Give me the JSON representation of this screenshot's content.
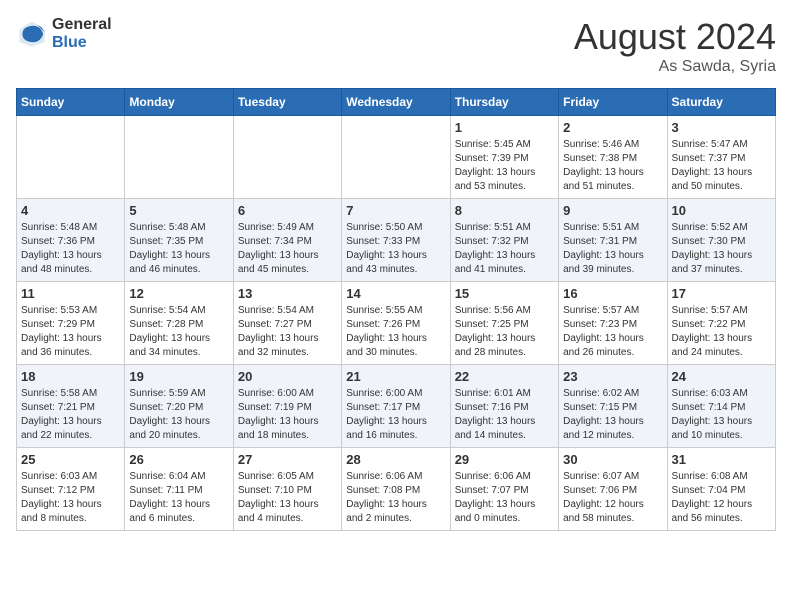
{
  "logo": {
    "general": "General",
    "blue": "Blue"
  },
  "header": {
    "month_year": "August 2024",
    "location": "As Sawda, Syria"
  },
  "weekdays": [
    "Sunday",
    "Monday",
    "Tuesday",
    "Wednesday",
    "Thursday",
    "Friday",
    "Saturday"
  ],
  "weeks": [
    [
      {
        "day": "",
        "info": ""
      },
      {
        "day": "",
        "info": ""
      },
      {
        "day": "",
        "info": ""
      },
      {
        "day": "",
        "info": ""
      },
      {
        "day": "1",
        "info": "Sunrise: 5:45 AM\nSunset: 7:39 PM\nDaylight: 13 hours\nand 53 minutes."
      },
      {
        "day": "2",
        "info": "Sunrise: 5:46 AM\nSunset: 7:38 PM\nDaylight: 13 hours\nand 51 minutes."
      },
      {
        "day": "3",
        "info": "Sunrise: 5:47 AM\nSunset: 7:37 PM\nDaylight: 13 hours\nand 50 minutes."
      }
    ],
    [
      {
        "day": "4",
        "info": "Sunrise: 5:48 AM\nSunset: 7:36 PM\nDaylight: 13 hours\nand 48 minutes."
      },
      {
        "day": "5",
        "info": "Sunrise: 5:48 AM\nSunset: 7:35 PM\nDaylight: 13 hours\nand 46 minutes."
      },
      {
        "day": "6",
        "info": "Sunrise: 5:49 AM\nSunset: 7:34 PM\nDaylight: 13 hours\nand 45 minutes."
      },
      {
        "day": "7",
        "info": "Sunrise: 5:50 AM\nSunset: 7:33 PM\nDaylight: 13 hours\nand 43 minutes."
      },
      {
        "day": "8",
        "info": "Sunrise: 5:51 AM\nSunset: 7:32 PM\nDaylight: 13 hours\nand 41 minutes."
      },
      {
        "day": "9",
        "info": "Sunrise: 5:51 AM\nSunset: 7:31 PM\nDaylight: 13 hours\nand 39 minutes."
      },
      {
        "day": "10",
        "info": "Sunrise: 5:52 AM\nSunset: 7:30 PM\nDaylight: 13 hours\nand 37 minutes."
      }
    ],
    [
      {
        "day": "11",
        "info": "Sunrise: 5:53 AM\nSunset: 7:29 PM\nDaylight: 13 hours\nand 36 minutes."
      },
      {
        "day": "12",
        "info": "Sunrise: 5:54 AM\nSunset: 7:28 PM\nDaylight: 13 hours\nand 34 minutes."
      },
      {
        "day": "13",
        "info": "Sunrise: 5:54 AM\nSunset: 7:27 PM\nDaylight: 13 hours\nand 32 minutes."
      },
      {
        "day": "14",
        "info": "Sunrise: 5:55 AM\nSunset: 7:26 PM\nDaylight: 13 hours\nand 30 minutes."
      },
      {
        "day": "15",
        "info": "Sunrise: 5:56 AM\nSunset: 7:25 PM\nDaylight: 13 hours\nand 28 minutes."
      },
      {
        "day": "16",
        "info": "Sunrise: 5:57 AM\nSunset: 7:23 PM\nDaylight: 13 hours\nand 26 minutes."
      },
      {
        "day": "17",
        "info": "Sunrise: 5:57 AM\nSunset: 7:22 PM\nDaylight: 13 hours\nand 24 minutes."
      }
    ],
    [
      {
        "day": "18",
        "info": "Sunrise: 5:58 AM\nSunset: 7:21 PM\nDaylight: 13 hours\nand 22 minutes."
      },
      {
        "day": "19",
        "info": "Sunrise: 5:59 AM\nSunset: 7:20 PM\nDaylight: 13 hours\nand 20 minutes."
      },
      {
        "day": "20",
        "info": "Sunrise: 6:00 AM\nSunset: 7:19 PM\nDaylight: 13 hours\nand 18 minutes."
      },
      {
        "day": "21",
        "info": "Sunrise: 6:00 AM\nSunset: 7:17 PM\nDaylight: 13 hours\nand 16 minutes."
      },
      {
        "day": "22",
        "info": "Sunrise: 6:01 AM\nSunset: 7:16 PM\nDaylight: 13 hours\nand 14 minutes."
      },
      {
        "day": "23",
        "info": "Sunrise: 6:02 AM\nSunset: 7:15 PM\nDaylight: 13 hours\nand 12 minutes."
      },
      {
        "day": "24",
        "info": "Sunrise: 6:03 AM\nSunset: 7:14 PM\nDaylight: 13 hours\nand 10 minutes."
      }
    ],
    [
      {
        "day": "25",
        "info": "Sunrise: 6:03 AM\nSunset: 7:12 PM\nDaylight: 13 hours\nand 8 minutes."
      },
      {
        "day": "26",
        "info": "Sunrise: 6:04 AM\nSunset: 7:11 PM\nDaylight: 13 hours\nand 6 minutes."
      },
      {
        "day": "27",
        "info": "Sunrise: 6:05 AM\nSunset: 7:10 PM\nDaylight: 13 hours\nand 4 minutes."
      },
      {
        "day": "28",
        "info": "Sunrise: 6:06 AM\nSunset: 7:08 PM\nDaylight: 13 hours\nand 2 minutes."
      },
      {
        "day": "29",
        "info": "Sunrise: 6:06 AM\nSunset: 7:07 PM\nDaylight: 13 hours\nand 0 minutes."
      },
      {
        "day": "30",
        "info": "Sunrise: 6:07 AM\nSunset: 7:06 PM\nDaylight: 12 hours\nand 58 minutes."
      },
      {
        "day": "31",
        "info": "Sunrise: 6:08 AM\nSunset: 7:04 PM\nDaylight: 12 hours\nand 56 minutes."
      }
    ]
  ]
}
